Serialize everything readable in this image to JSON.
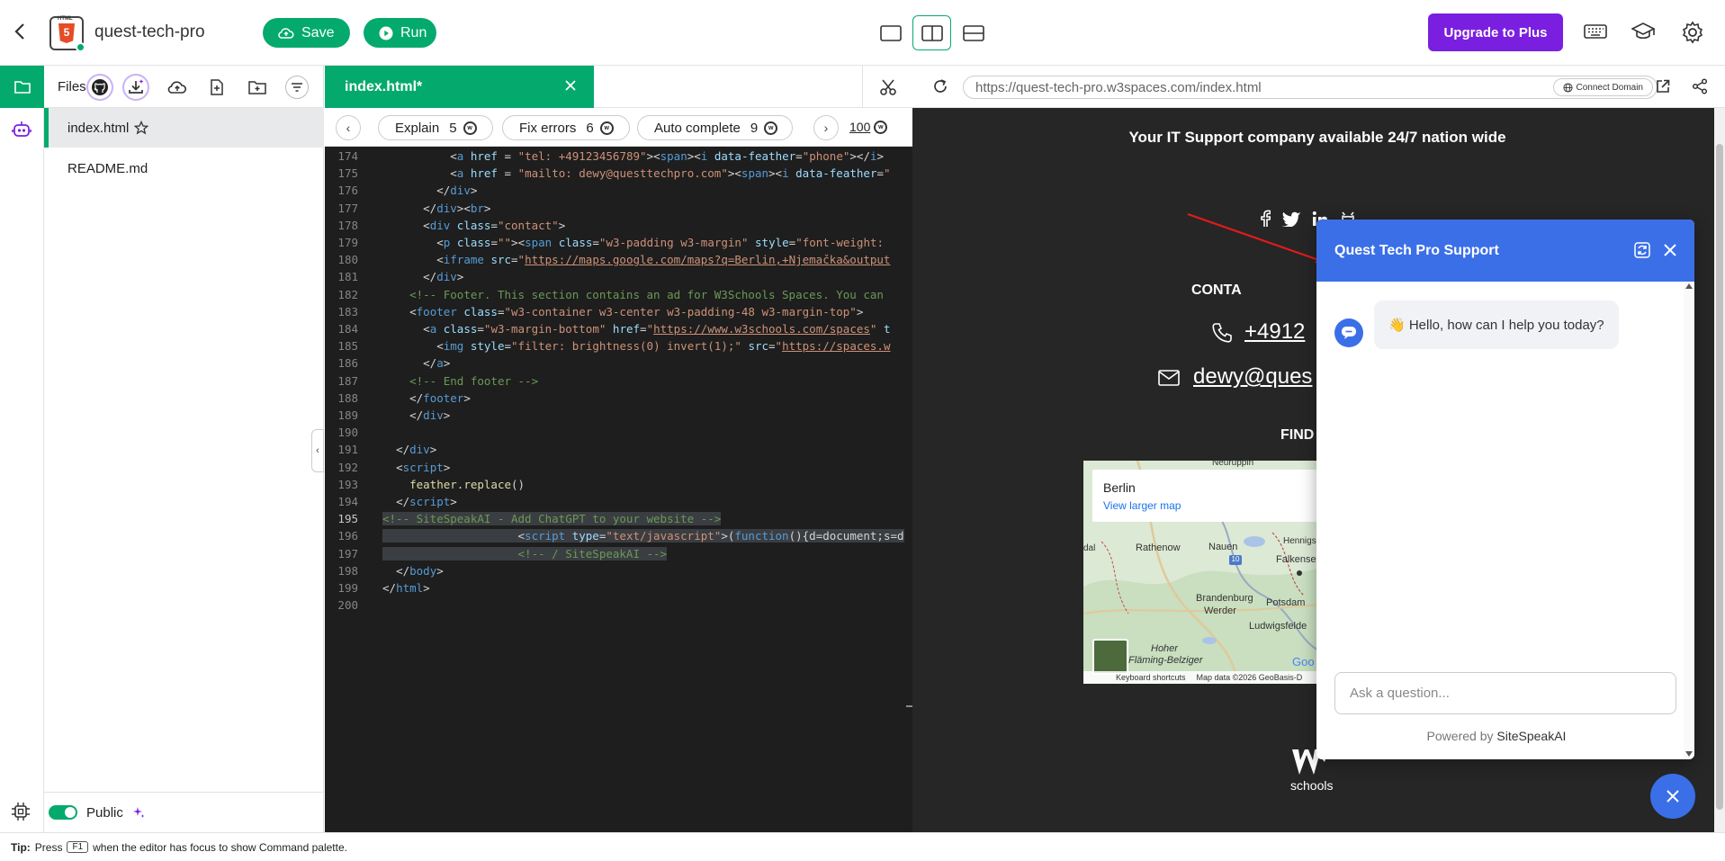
{
  "header": {
    "project_name": "quest-tech-pro",
    "save_label": "Save",
    "run_label": "Run",
    "upgrade_label": "Upgrade to Plus",
    "logo_tag": "HTML",
    "logo_number": "5"
  },
  "files_panel": {
    "title": "Files",
    "files": [
      {
        "name": "index.html",
        "active": true
      },
      {
        "name": "README.md",
        "active": false
      }
    ],
    "public_label": "Public"
  },
  "editor": {
    "tab_label": "index.html*",
    "ai_actions": [
      {
        "label": "Explain",
        "count": "5"
      },
      {
        "label": "Fix errors",
        "count": "6"
      },
      {
        "label": "Auto complete",
        "count": "9"
      }
    ],
    "credits": "100",
    "lines": [
      {
        "n": "174",
        "html": "          <span class='w'>&lt;</span><span class='t'>a</span> <span class='a'>href</span> <span class='w'>=</span> <span class='s'>\"tel: +49123456789\"</span><span class='w'>&gt;&lt;</span><span class='t'>span</span><span class='w'>&gt;&lt;</span><span class='t'>i</span> <span class='a'>data-feather</span><span class='w'>=</span><span class='s'>\"phone\"</span><span class='w'>&gt;&lt;/</span><span class='t'>i</span><span class='w'>&gt;</span>"
      },
      {
        "n": "175",
        "html": "          <span class='w'>&lt;</span><span class='t'>a</span> <span class='a'>href</span> <span class='w'>=</span> <span class='s'>\"mailto: dewy@questtechpro.com\"</span><span class='w'>&gt;&lt;</span><span class='t'>span</span><span class='w'>&gt;&lt;</span><span class='t'>i</span> <span class='a'>data-feather</span><span class='w'>=</span><span class='s'>\"</span>"
      },
      {
        "n": "176",
        "html": "        <span class='w'>&lt;/</span><span class='t'>div</span><span class='w'>&gt;</span>"
      },
      {
        "n": "177",
        "html": "      <span class='w'>&lt;/</span><span class='t'>div</span><span class='w'>&gt;&lt;</span><span class='t'>br</span><span class='w'>&gt;</span>"
      },
      {
        "n": "178",
        "html": "      <span class='w'>&lt;</span><span class='t'>div</span> <span class='a'>class</span><span class='w'>=</span><span class='s'>\"contact\"</span><span class='w'>&gt;</span>"
      },
      {
        "n": "179",
        "html": "        <span class='w'>&lt;</span><span class='t'>p</span> <span class='a'>class</span><span class='w'>=</span><span class='s'>\"\"</span><span class='w'>&gt;&lt;</span><span class='t'>span</span> <span class='a'>class</span><span class='w'>=</span><span class='s'>\"w3-padding w3-margin\"</span> <span class='a'>style</span><span class='w'>=</span><span class='s'>\"font-weight:</span>"
      },
      {
        "n": "180",
        "html": "        <span class='w'>&lt;</span><span class='t'>iframe</span> <span class='a'>src</span><span class='w'>=</span><span class='s'>\"</span><span class='u'>https://maps.google.com/maps?q=Berlin,+Njemačka&amp;output</span>"
      },
      {
        "n": "181",
        "html": "      <span class='w'>&lt;/</span><span class='t'>div</span><span class='w'>&gt;</span>"
      },
      {
        "n": "182",
        "html": "    <span class='c'>&lt;!-- Footer. This section contains an ad for W3Schools Spaces. You can</span>"
      },
      {
        "n": "183",
        "html": "    <span class='w'>&lt;</span><span class='t'>footer</span> <span class='a'>class</span><span class='w'>=</span><span class='s'>\"w3-container w3-center w3-padding-48 w3-margin-top\"</span><span class='w'>&gt;</span>"
      },
      {
        "n": "184",
        "html": "      <span class='w'>&lt;</span><span class='t'>a</span> <span class='a'>class</span><span class='w'>=</span><span class='s'>\"w3-margin-bottom\"</span> <span class='a'>href</span><span class='w'>=</span><span class='s'>\"</span><span class='u'>https://www.w3schools.com/spaces</span><span class='s'>\"</span> <span class='a'>t</span>"
      },
      {
        "n": "185",
        "html": "        <span class='w'>&lt;</span><span class='t'>img</span> <span class='a'>style</span><span class='w'>=</span><span class='s'>\"filter: brightness(0) invert(1);\"</span> <span class='a'>src</span><span class='w'>=</span><span class='s'>\"</span><span class='u'>https://spaces.w</span>"
      },
      {
        "n": "186",
        "html": "      <span class='w'>&lt;/</span><span class='t'>a</span><span class='w'>&gt;</span>"
      },
      {
        "n": "187",
        "html": "    <span class='c'>&lt;!-- End footer --&gt;</span>"
      },
      {
        "n": "188",
        "html": "    <span class='w'>&lt;/</span><span class='t'>footer</span><span class='w'>&gt;</span>"
      },
      {
        "n": "189",
        "html": "    <span class='w'>&lt;/</span><span class='t'>div</span><span class='w'>&gt;</span>"
      },
      {
        "n": "190",
        "html": ""
      },
      {
        "n": "191",
        "html": "  <span class='w'>&lt;/</span><span class='t'>div</span><span class='w'>&gt;</span>"
      },
      {
        "n": "192",
        "html": "  <span class='w'>&lt;</span><span class='t'>script</span><span class='w'>&gt;</span>"
      },
      {
        "n": "193",
        "html": "    <span class='f'>feather</span><span class='w'>.</span><span class='f'>replace</span><span class='w'>()</span>"
      },
      {
        "n": "194",
        "html": "  <span class='w'>&lt;/</span><span class='t'>script</span><span class='w'>&gt;</span>"
      },
      {
        "n": "195",
        "html": "<span class='sel'><span class='c'>&lt;!-- SiteSpeakAI - Add ChatGPT to your website --&gt;</span></span>",
        "current": true
      },
      {
        "n": "196",
        "html": "<span class='sel'>                    <span class='w'>&lt;</span><span class='t'>script</span> <span class='a'>type</span><span class='w'>=</span><span class='s'>\"text/javascript\"</span><span class='w'>&gt;(</span><span class='t'>function</span><span class='w'>(){d=document;s=d</span></span>"
      },
      {
        "n": "197",
        "html": "<span class='sel'>                    <span class='c'>&lt;!-- / SiteSpeakAI --&gt;</span></span>"
      },
      {
        "n": "198",
        "html": "  <span class='w'>&lt;/</span><span class='t'>body</span><span class='w'>&gt;</span>"
      },
      {
        "n": "199",
        "html": "<span class='w'>&lt;/</span><span class='t'>html</span><span class='w'>&gt;</span>"
      },
      {
        "n": "200",
        "html": ""
      }
    ]
  },
  "preview": {
    "url": "https://quest-tech-pro.w3spaces.com/index.html",
    "connect_domain_label": "Connect Domain",
    "tagline": "Your IT Support company available 24/7 nation wide",
    "contact_heading": "CONTA",
    "phone_text": "+4912",
    "email_text": "dewy@ques",
    "find_heading": "FIND",
    "map": {
      "place": "Berlin",
      "larger_map_link": "View larger map",
      "towns": [
        "Neuruppin",
        "Hennigs",
        "Rathenow",
        "Nauen",
        "Falkensee",
        "Brandenburg",
        "Werder",
        "Potsdam",
        "Ludwigsfelde",
        "Hoher",
        "Fläming-Belziger",
        "dal",
        "10"
      ],
      "keyboard_shortcuts": "Keyboard shortcuts",
      "attribution": "Map data ©2026 GeoBasis-D",
      "google": "Goo"
    },
    "footer_logo": "schools"
  },
  "chat": {
    "title": "Quest Tech Pro Support",
    "greeting": "👋 Hello, how can I help you today?",
    "input_placeholder": "Ask a question...",
    "powered_prefix": "Powered by ",
    "powered_brand": "SiteSpeakAI"
  },
  "tip": {
    "prefix": "Tip:",
    "text_before": "Press",
    "key": "F1",
    "text_after": "when the editor has focus to show Command palette."
  },
  "colors": {
    "brand_green": "#04aa6d",
    "upgrade_purple": "#7a1fe0",
    "chat_blue": "#3b6fe8",
    "editor_bg": "#1e1e1e"
  }
}
